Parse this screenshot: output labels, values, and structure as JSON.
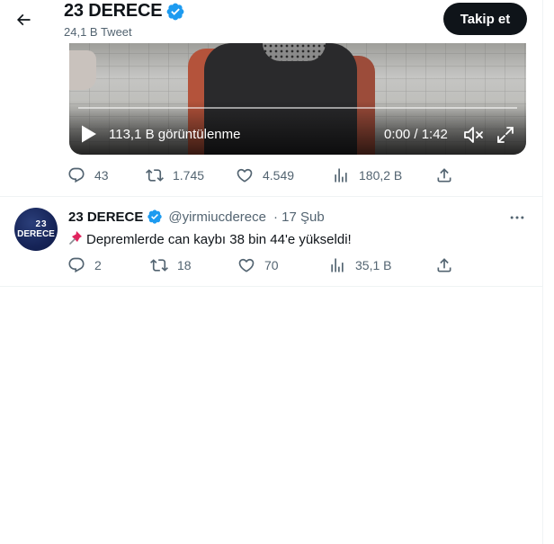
{
  "header": {
    "title": "23 DERECE",
    "subtitle": "24,1 B Tweet",
    "follow_label": "Takip et"
  },
  "video": {
    "views": "113,1 B görüntülenme",
    "time": "0:00 / 1:42",
    "progress": 0
  },
  "tweet1": {
    "replies": "43",
    "retweets": "1.745",
    "likes": "4.549",
    "views": "180,2 B"
  },
  "tweet2": {
    "avatar_line1": "23",
    "avatar_line2": "DERECE",
    "name": "23 DERECE",
    "handle": "@yirmiucderece",
    "date": "· 17 Şub",
    "text": "Depremlerde can kaybı 38 bin 44'e yükseldi!",
    "replies": "2",
    "retweets": "18",
    "likes": "70",
    "views": "35,1 B"
  },
  "colors": {
    "verified": "#1d9bf0",
    "muted": "#536471",
    "text": "#0f1419",
    "avatar_bg": "#162458"
  },
  "icons": [
    "back-arrow-icon",
    "verified-badge-icon",
    "play-icon",
    "mute-icon",
    "fullscreen-icon",
    "reply-icon",
    "retweet-icon",
    "like-icon",
    "views-icon",
    "share-icon",
    "pin-icon",
    "more-icon"
  ]
}
